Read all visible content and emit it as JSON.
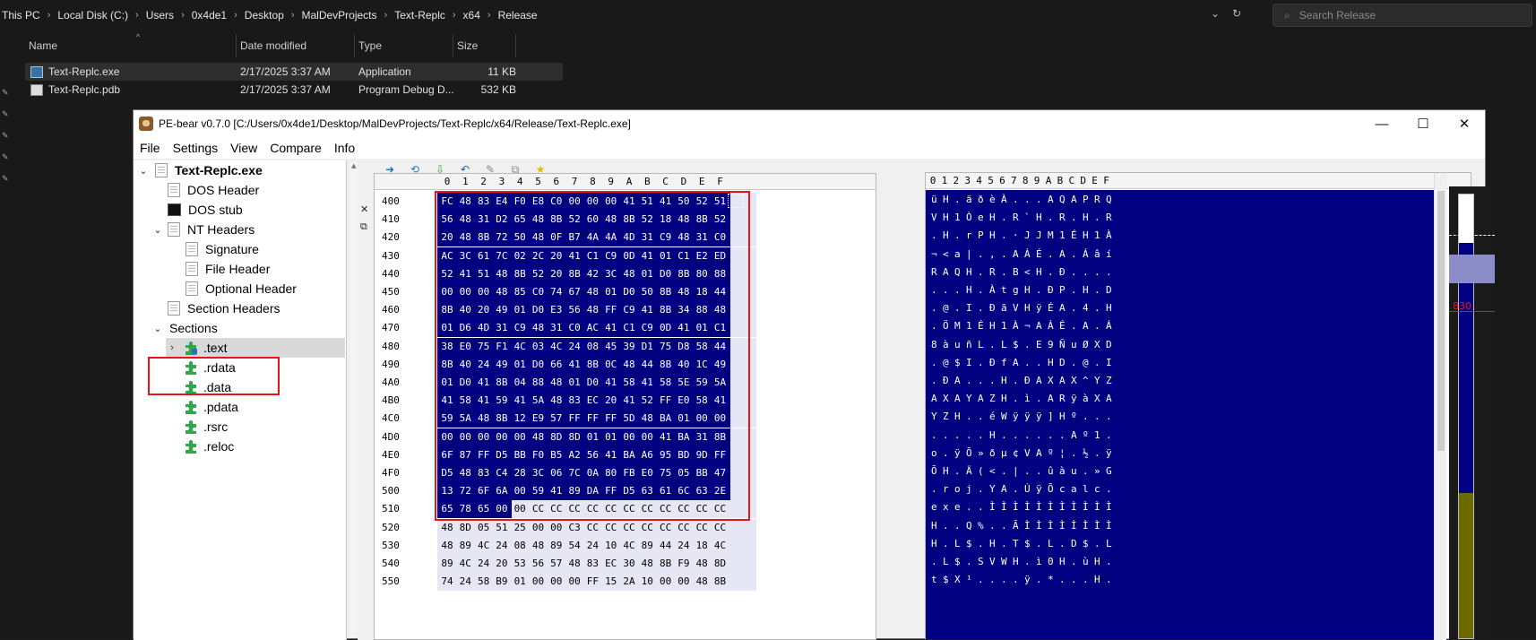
{
  "explorer": {
    "breadcrumb": [
      "This PC",
      "Local Disk (C:)",
      "Users",
      "0x4de1",
      "Desktop",
      "MalDevProjects",
      "Text-Replc",
      "x64",
      "Release"
    ],
    "search_placeholder": "Search Release",
    "columns": [
      "Name",
      "Date modified",
      "Type",
      "Size"
    ],
    "files": [
      {
        "name": "Text-Replc.exe",
        "date": "2/17/2025 3:37 AM",
        "type": "Application",
        "size": "11 KB"
      },
      {
        "name": "Text-Replc.pdb",
        "date": "2/17/2025 3:37 AM",
        "type": "Program Debug D...",
        "size": "532 KB"
      }
    ]
  },
  "pebear": {
    "title": "PE-bear v0.7.0 [C:/Users/0x4de1/Desktop/MalDevProjects/Text-Replc/x64/Release/Text-Replc.exe]",
    "menu": [
      "File",
      "Settings",
      "View",
      "Compare",
      "Info"
    ],
    "tree": {
      "root": "Text-Replc.exe",
      "dos_header": "DOS Header",
      "dos_stub": "DOS stub",
      "nt_headers": "NT Headers",
      "signature": "Signature",
      "file_header": "File Header",
      "optional_header": "Optional Header",
      "section_headers": "Section Headers",
      "sections": "Sections",
      "section_items": [
        ".text",
        ".rdata",
        ".data",
        ".pdata",
        ".rsrc",
        ".reloc"
      ]
    },
    "side_tools": [
      "✕",
      "⧉"
    ],
    "hex_columns": [
      "0",
      "1",
      "2",
      "3",
      "4",
      "5",
      "6",
      "7",
      "8",
      "9",
      "A",
      "B",
      "C",
      "D",
      "E",
      "F"
    ],
    "hex_rows": [
      {
        "addr": "400",
        "bytes": "FC 48 83 E4 F0 E8 C0 00 00 00 41 51 41 50 52 51",
        "ascii": "üH.äðèÀ...AQAPRQ"
      },
      {
        "addr": "410",
        "bytes": "56 48 31 D2 65 48 8B 52 60 48 8B 52 18 48 8B 52",
        "ascii": "VH1ÒeH.R`H.R.H.R"
      },
      {
        "addr": "420",
        "bytes": "20 48 8B 72 50 48 0F B7 4A 4A 4D 31 C9 48 31 C0",
        "ascii": ".H.rPH.·JJM1ÉH1À"
      },
      {
        "addr": "430",
        "bytes": "AC 3C 61 7C 02 2C 20 41 C1 C9 0D 41 01 C1 E2 ED",
        "ascii": "¬<a|.,.AÁÉ.A.Áâí"
      },
      {
        "addr": "440",
        "bytes": "52 41 51 48 8B 52 20 8B 42 3C 48 01 D0 8B 80 88",
        "ascii": "RAQH.R.B<H.Ð...."
      },
      {
        "addr": "450",
        "bytes": "00 00 00 48 85 C0 74 67 48 01 D0 50 8B 48 18 44",
        "ascii": "...H.ÀtgH.ÐP.H.D"
      },
      {
        "addr": "460",
        "bytes": "8B 40 20 49 01 D0 E3 56 48 FF C9 41 8B 34 88 48",
        "ascii": ".@.I.ÐãVHÿÉA.4.H"
      },
      {
        "addr": "470",
        "bytes": "01 D6 4D 31 C9 48 31 C0 AC 41 C1 C9 0D 41 01 C1",
        "ascii": ".ÖM1ÉH1À¬AÁÉ.A.Á"
      },
      {
        "addr": "480",
        "bytes": "38 E0 75 F1 4C 03 4C 24 08 45 39 D1 75 D8 58 44",
        "ascii": "8àuñL.L$.E9ÑuØXD"
      },
      {
        "addr": "490",
        "bytes": "8B 40 24 49 01 D0 66 41 8B 0C 48 44 8B 40 1C 49",
        "ascii": ".@$I.ÐfA..HD.@.I"
      },
      {
        "addr": "4A0",
        "bytes": "01 D0 41 8B 04 88 48 01 D0 41 58 41 58 5E 59 5A",
        "ascii": ".ÐA...H.ÐAXAX^YZ"
      },
      {
        "addr": "4B0",
        "bytes": "41 58 41 59 41 5A 48 83 EC 20 41 52 FF E0 58 41",
        "ascii": "AXAYAZH.ì.ARÿàXA"
      },
      {
        "addr": "4C0",
        "bytes": "59 5A 48 8B 12 E9 57 FF FF FF 5D 48 BA 01 00 00",
        "ascii": "YZH..éWÿÿÿ]Hº..."
      },
      {
        "addr": "4D0",
        "bytes": "00 00 00 00 00 48 8D 8D 01 01 00 00 41 BA 31 8B",
        "ascii": ".....H......Aº1."
      },
      {
        "addr": "4E0",
        "bytes": "6F 87 FF D5 BB F0 B5 A2 56 41 BA A6 95 BD 9D FF",
        "ascii": "o.ÿÕ»ðµ¢VAº¦.½.ÿ"
      },
      {
        "addr": "4F0",
        "bytes": "D5 48 83 C4 28 3C 06 7C 0A 80 FB E0 75 05 BB 47",
        "ascii": "ÕH.Ä(<.|..ûàu.»G"
      },
      {
        "addr": "500",
        "bytes": "13 72 6F 6A 00 59 41 89 DA FF D5 63 61 6C 63 2E",
        "ascii": ".roj.YA.ÚÿÕcalc."
      },
      {
        "addr": "510",
        "bytes": "65 78 65 00 00 CC CC CC CC CC CC CC CC CC CC CC",
        "ascii": "exe..ÌÌÌÌÌÌÌÌÌÌÌ"
      },
      {
        "addr": "520",
        "bytes": "48 8D 05 51 25 00 00 C3 CC CC CC CC CC CC CC CC",
        "ascii": "H..Q%..ÃÌÌÌÌÌÌÌÌ"
      },
      {
        "addr": "530",
        "bytes": "48 89 4C 24 08 48 89 54 24 10 4C 89 44 24 18 4C",
        "ascii": "H.L$.H.T$.L.D$.L"
      },
      {
        "addr": "540",
        "bytes": "89 4C 24 20 53 56 57 48 83 EC 30 48 8B F9 48 8D",
        "ascii": ".L$.SVWH.ì0H.ùH."
      },
      {
        "addr": "550",
        "bytes": "74 24 58 B9 01 00 00 00 FF 15 2A 10 00 00 48 8B",
        "ascii": "t$X¹....ÿ.*...H."
      }
    ],
    "entropy_marker": "830",
    "colors": {
      "selection": "#000080",
      "highlight_box": "#e8141c"
    }
  }
}
